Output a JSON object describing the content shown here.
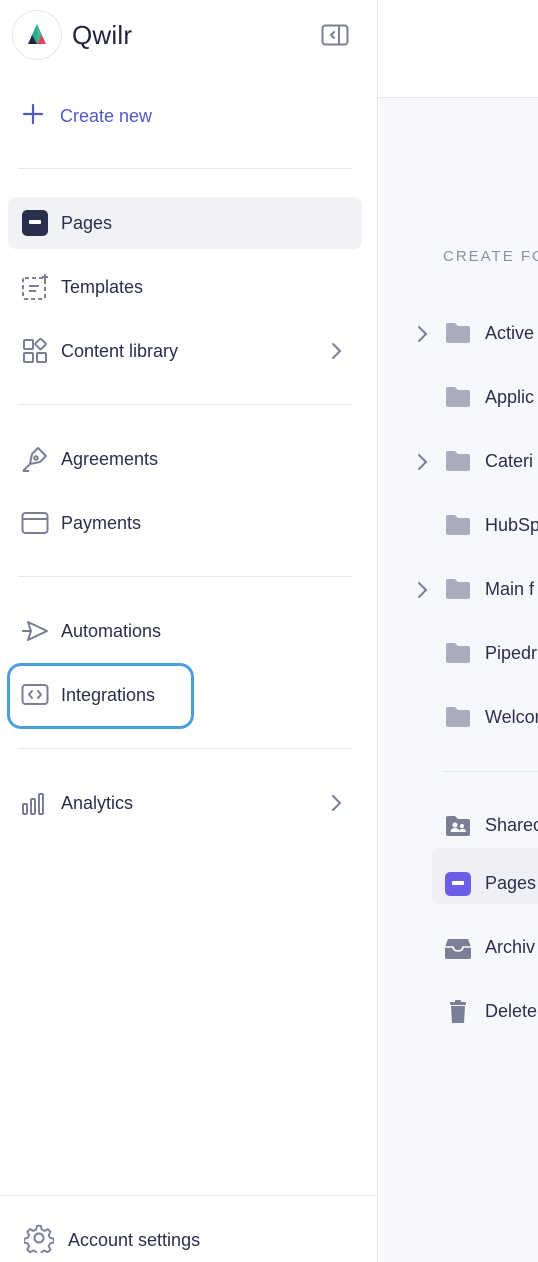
{
  "app": {
    "brand_name": "Qwilr"
  },
  "sidebar": {
    "create_new_label": "Create new",
    "nav": [
      {
        "label": "Pages",
        "icon": "pages-icon",
        "active": true
      },
      {
        "label": "Templates",
        "icon": "templates-icon"
      },
      {
        "label": "Content library",
        "icon": "content-library-icon",
        "has_submenu": true
      },
      {
        "label": "Agreements",
        "icon": "pen-nib-icon"
      },
      {
        "label": "Payments",
        "icon": "card-icon"
      },
      {
        "label": "Automations",
        "icon": "automations-icon"
      },
      {
        "label": "Integrations",
        "icon": "code-icon",
        "highlighted": true
      },
      {
        "label": "Analytics",
        "icon": "bar-chart-icon",
        "has_submenu": true
      }
    ],
    "account_settings_label": "Account settings"
  },
  "main": {
    "section_label": "CREATE FO",
    "folders": [
      {
        "label": "Active",
        "expandable": true
      },
      {
        "label": "Applic",
        "expandable": false
      },
      {
        "label": "Cateri",
        "expandable": true
      },
      {
        "label": "HubSp",
        "expandable": false
      },
      {
        "label": "Main f",
        "expandable": true
      },
      {
        "label": "Pipedr",
        "expandable": false
      },
      {
        "label": "Welcor",
        "expandable": false
      }
    ],
    "special_folders": [
      {
        "label": "Sharec",
        "icon": "shared-folder-icon"
      },
      {
        "label": "Pages",
        "icon": "pages-icon",
        "selected": true
      },
      {
        "label": "Archiv",
        "icon": "archive-icon"
      },
      {
        "label": "Delete",
        "icon": "trash-icon"
      }
    ]
  },
  "colors": {
    "accent": "#4f5ac7",
    "highlight": "#4ba0dc",
    "pages_purple": "#6b5fe8",
    "icon_gray": "#7a7f96",
    "folder_gray": "#a9adbd"
  }
}
